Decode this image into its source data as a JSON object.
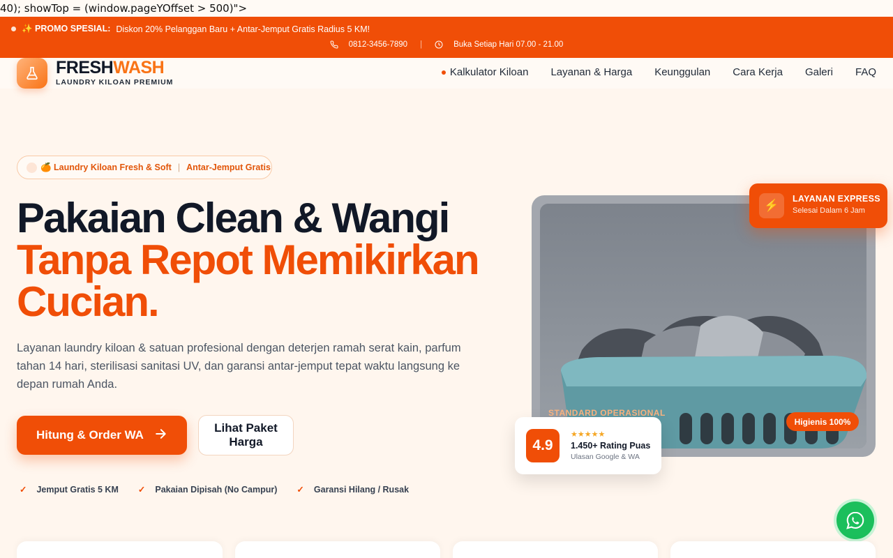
{
  "stray_code": "40); showTop = (window.pageYOffset > 500)\">",
  "promo": {
    "icon": "sparkles-icon",
    "label": "✨ PROMO SPESIAL:",
    "text": "Diskon 20% Pelanggan Baru + Antar-Jemput Gratis Radius 5 KM!",
    "phone": "0812-3456-7890",
    "hours": "Buka Setiap Hari 07.00 - 21.00"
  },
  "brand": {
    "name_part1": "FRESH",
    "name_part2": "WASH",
    "tagline": "LAUNDRY KILOAN PREMIUM",
    "accent": "#f04e07"
  },
  "menu": [
    {
      "label": "Kalkulator Kiloan"
    },
    {
      "label": "Layanan & Harga"
    },
    {
      "label": "Keunggulan"
    },
    {
      "label": "Cara Kerja"
    },
    {
      "label": "Galeri"
    },
    {
      "label": "FAQ"
    }
  ],
  "hero": {
    "badge_text": "🍊 Laundry Kiloan Fresh & Soft",
    "badge_separator": "|",
    "badge_highlight": "Antar-Jemput Gratis",
    "headline_line1": "Pakaian Clean & Wangi",
    "headline_line2": "Tanpa Repot Memikirkan",
    "headline_line3": "Cucian.",
    "lead": "Layanan laundry kiloan & satuan profesional dengan deterjen ramah serat kain, parfum tahan 14 hari, sterilisasi sanitasi UV, dan garansi antar-jemput tepat waktu langsung ke depan rumah Anda.",
    "cta_primary": "Hitung & Order WA",
    "cta_secondary": "Lihat Paket Harga",
    "checks": [
      {
        "mark": "✓",
        "label": "Jemput Gratis 5 KM"
      },
      {
        "mark": "✓",
        "label": "Pakaian Dipisah (No Campur)"
      },
      {
        "mark": "✓",
        "label": "Garansi Hilang / Rusak"
      }
    ]
  },
  "express": {
    "icon": "lightning-icon",
    "title": "LAYANAN EXPRESS",
    "subtitle": "Selesai Dalam 6 Jam"
  },
  "photo": {
    "caption": "STANDARD OPERASIONAL",
    "badge": "Higienis 100%"
  },
  "rating": {
    "score": "4.9",
    "stars": "★★★★★",
    "title": "1.450+ Rating Puas",
    "subtitle": "Ulasan Google & WA"
  }
}
